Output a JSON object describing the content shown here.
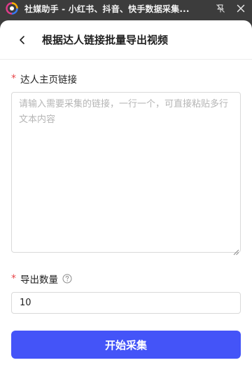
{
  "window": {
    "title": "社媒助手 - 小红书、抖音、快手数据采集..."
  },
  "header": {
    "title": "根据达人链接批量导出视频"
  },
  "form": {
    "links_field": {
      "label": "达人主页链接",
      "required_mark": "*",
      "placeholder": "请输入需要采集的链接，一行一个，可直接粘贴多行文本内容",
      "value": ""
    },
    "count_field": {
      "label": "导出数量",
      "required_mark": "*",
      "value": "10"
    },
    "submit_label": "开始采集"
  },
  "icons": {
    "app": "app-logo-icon",
    "unpin": "pin-off-icon",
    "close": "close-icon",
    "back": "chevron-left-icon",
    "help": "question-circle-icon"
  },
  "colors": {
    "titlebar_bg": "#3c3c3c",
    "primary": "#4454f8",
    "required": "#e8474b",
    "placeholder": "#b5b5b5"
  }
}
